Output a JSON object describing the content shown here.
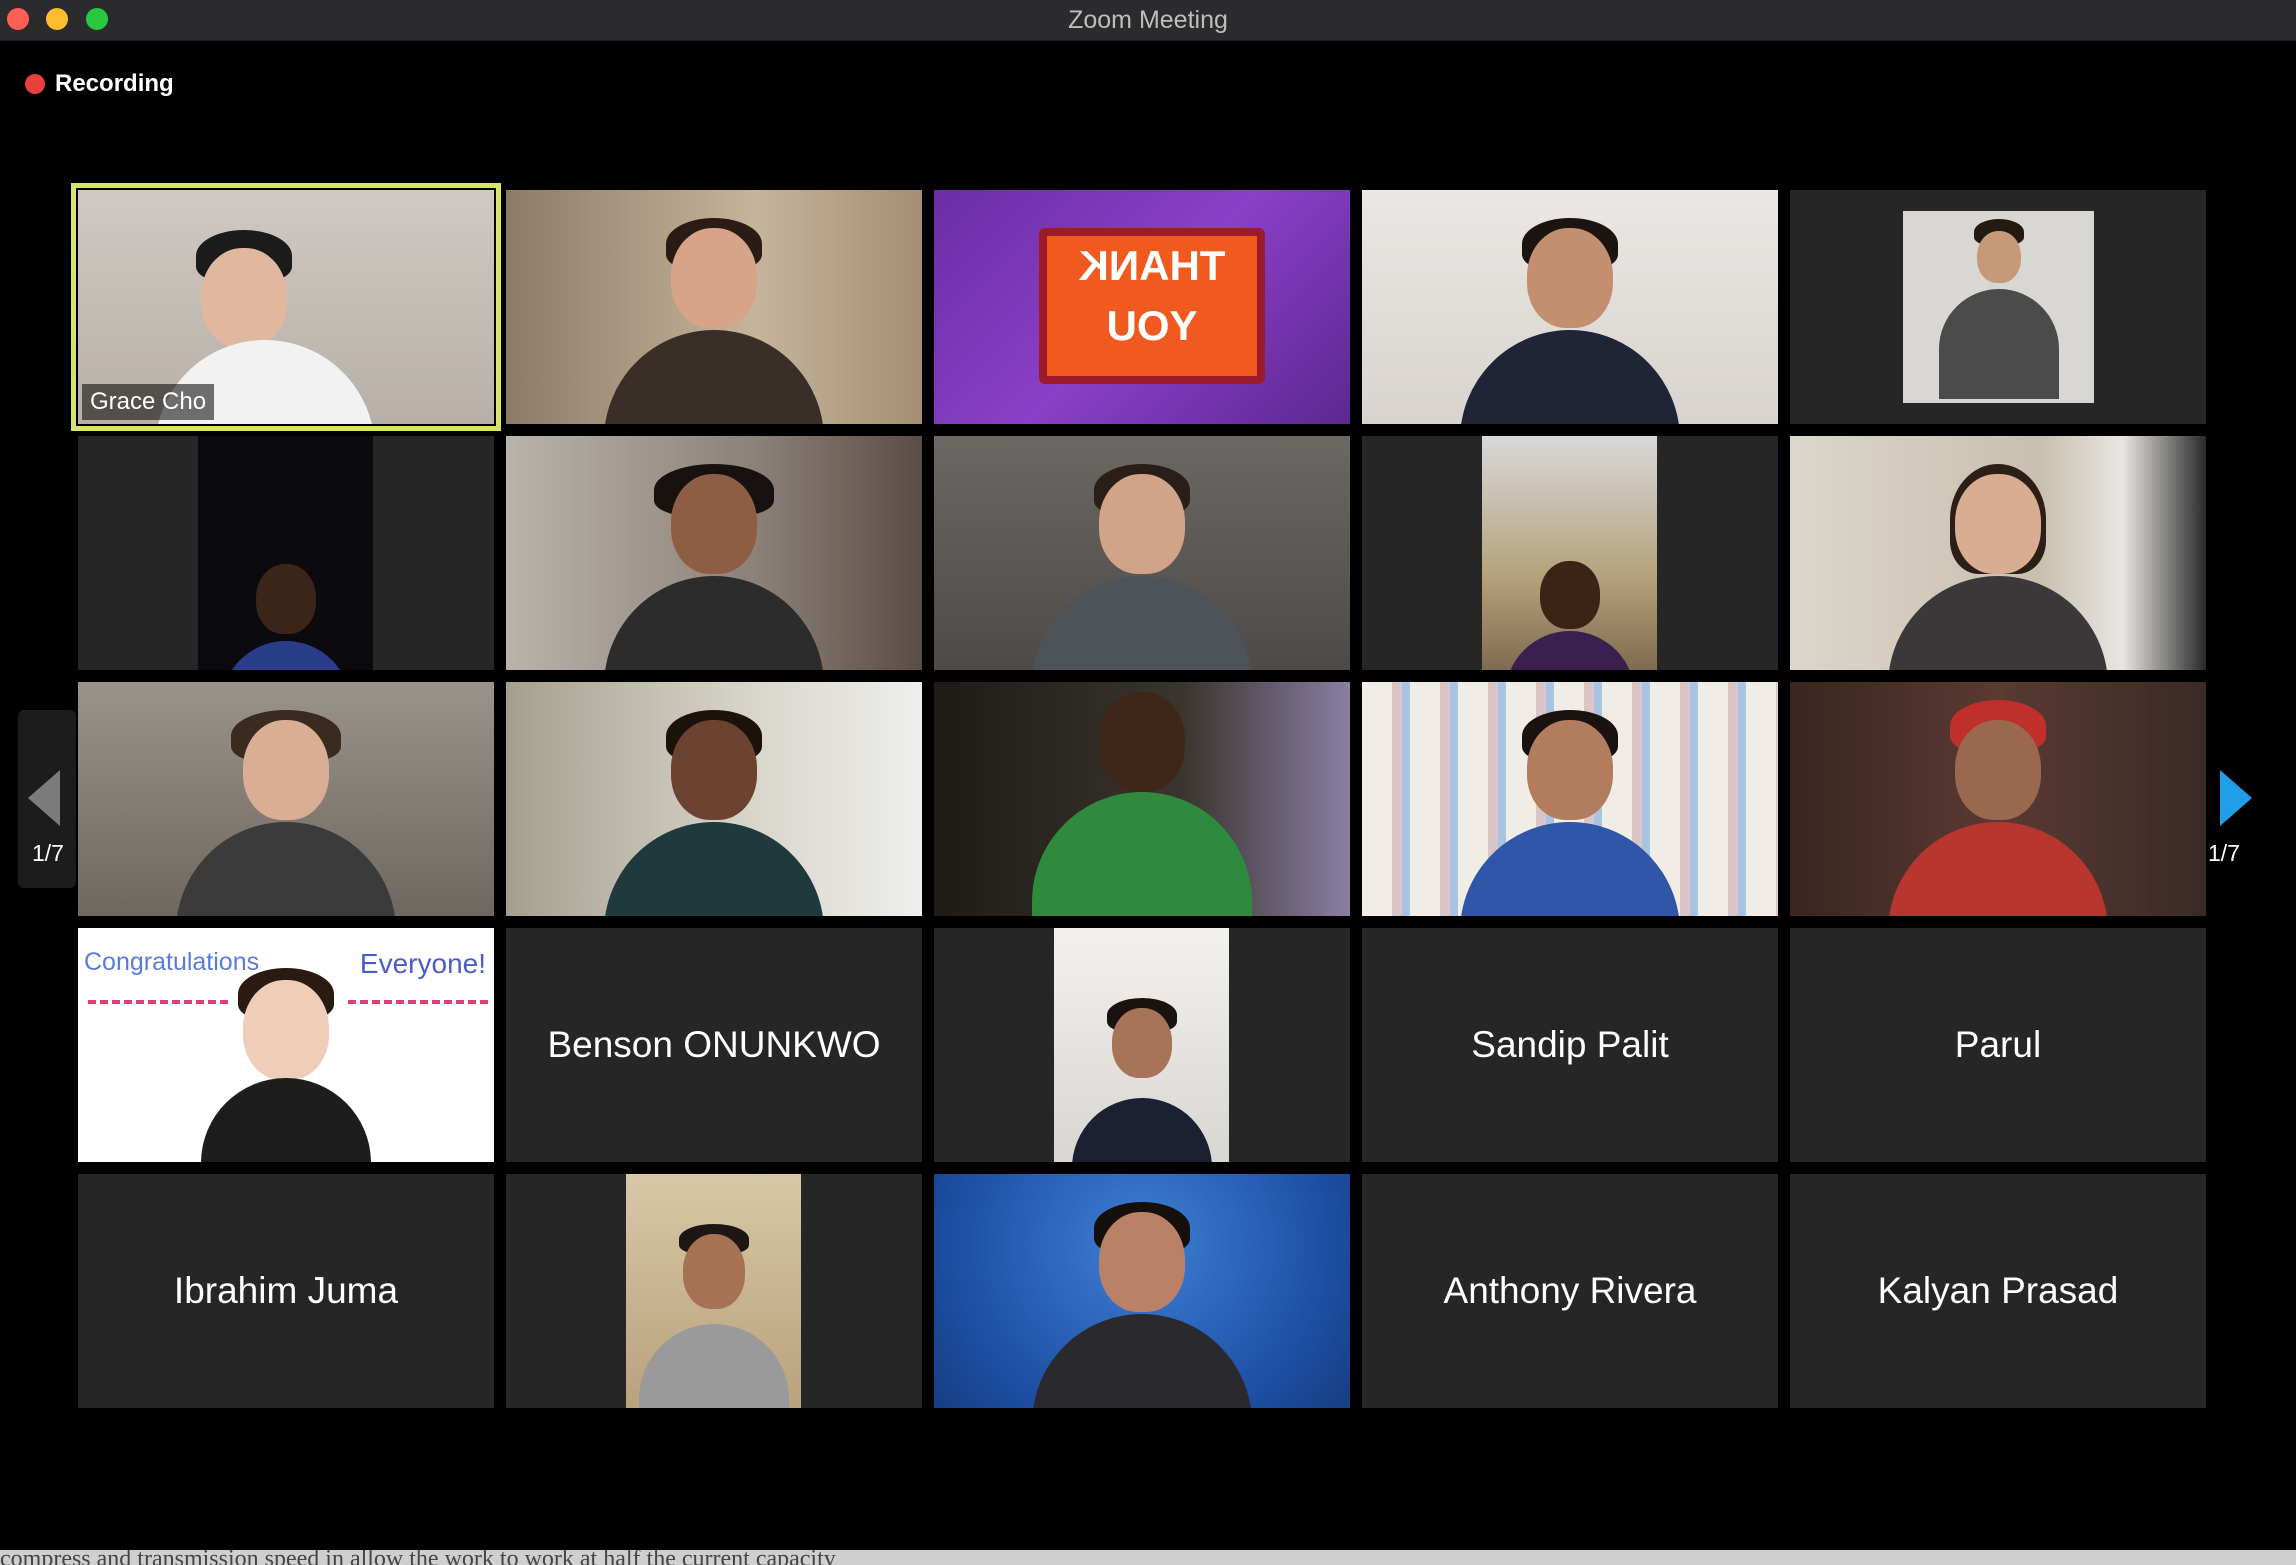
{
  "window": {
    "title": "Zoom Meeting"
  },
  "recording": {
    "label": "Recording"
  },
  "pagination": {
    "left": "1/7",
    "right": "1/7"
  },
  "tiles": {
    "grace": {
      "name": "Grace Cho"
    },
    "thankyou": {
      "line1": "THANK",
      "line2": "YOU"
    },
    "congrats": {
      "left": "Congratulations",
      "right": "Everyone!"
    },
    "benson": {
      "name": "Benson ONUNKWO"
    },
    "sandip": {
      "name": "Sandip Palit"
    },
    "parul": {
      "name": "Parul"
    },
    "ibrahim": {
      "name": "Ibrahim Juma"
    },
    "anthony": {
      "name": "Anthony Rivera"
    },
    "kalyan": {
      "name": "Kalyan Prasad"
    }
  },
  "background_text": "compress and transmission speed in allow the work to work at half the current capacity"
}
